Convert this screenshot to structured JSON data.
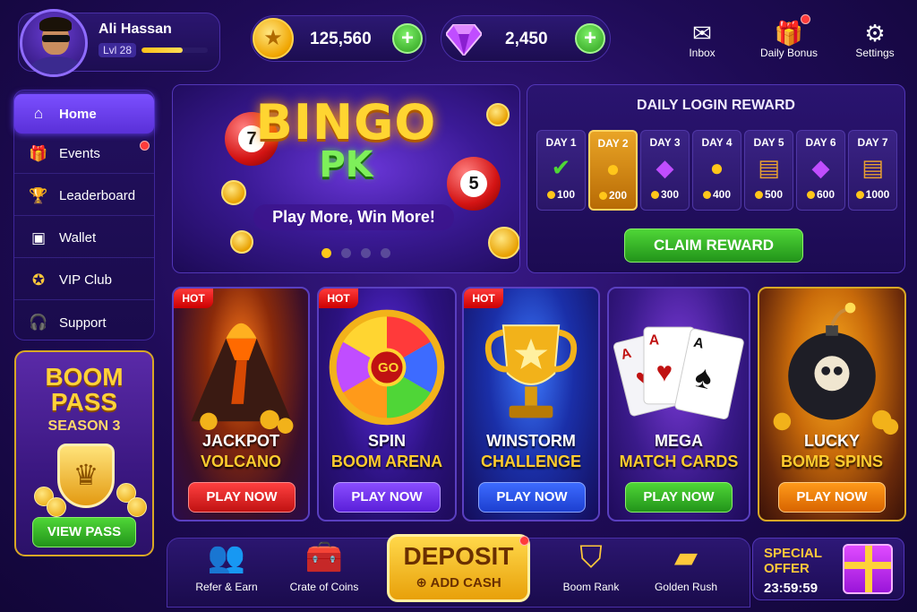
{
  "profile": {
    "name": "Ali Hassan",
    "level": "Lvl 28",
    "xp_progress": 0.62
  },
  "currency": {
    "coins": "125,560",
    "gems": "2,450"
  },
  "top_icons": {
    "inbox": "Inbox",
    "daily_bonus": "Daily Bonus",
    "settings": "Settings"
  },
  "sidebar": {
    "items": [
      {
        "label": "Home",
        "icon": "home-icon"
      },
      {
        "label": "Events",
        "icon": "gift-icon"
      },
      {
        "label": "Leaderboard",
        "icon": "trophy-icon"
      },
      {
        "label": "Wallet",
        "icon": "wallet-icon"
      },
      {
        "label": "VIP Club",
        "icon": "star-icon"
      },
      {
        "label": "Support",
        "icon": "headset-icon"
      }
    ]
  },
  "boom_pass": {
    "title_line1": "BOOM",
    "title_line2": "PASS",
    "season": "SEASON 3",
    "button": "VIEW PASS"
  },
  "banner": {
    "title": "BINGO",
    "subtitle": "PK",
    "tagline": "Play More, Win More!",
    "ball_left": "7",
    "ball_right": "5",
    "slides": 4,
    "active_slide": 1
  },
  "daily_reward": {
    "title": "DAILY LOGIN REWARD",
    "days": [
      {
        "label": "DAY 1",
        "amount": "100",
        "icon": "check-icon"
      },
      {
        "label": "DAY 2",
        "amount": "200",
        "icon": "coins-icon"
      },
      {
        "label": "DAY 3",
        "amount": "300",
        "icon": "gem-icon"
      },
      {
        "label": "DAY 4",
        "amount": "400",
        "icon": "coins-icon"
      },
      {
        "label": "DAY 5",
        "amount": "500",
        "icon": "chest-icon"
      },
      {
        "label": "DAY 6",
        "amount": "600",
        "icon": "gem-icon"
      },
      {
        "label": "DAY 7",
        "amount": "1000",
        "icon": "chest-icon"
      }
    ],
    "current_day": 2,
    "claim_button": "CLAIM REWARD"
  },
  "games": [
    {
      "line1": "JACKPOT",
      "line2": "VOLCANO",
      "badge": "HOT",
      "button": "PLAY NOW"
    },
    {
      "line1": "SPIN",
      "line2": "BOOM ARENA",
      "badge": "HOT",
      "button": "PLAY NOW",
      "wheel_center": "GO"
    },
    {
      "line1": "WINSTORM",
      "line2": "CHALLENGE",
      "badge": "HOT",
      "button": "PLAY NOW"
    },
    {
      "line1": "MEGA",
      "line2": "MATCH CARDS",
      "badge": "",
      "button": "PLAY NOW"
    },
    {
      "line1": "LUCKY",
      "line2": "BOMB SPINS",
      "badge": "",
      "button": "PLAY NOW"
    }
  ],
  "bottom_bar": {
    "refer": "Refer & Earn",
    "crate": "Crate of Coins",
    "deposit_title": "DEPOSIT",
    "deposit_sub": "ADD CASH",
    "rank": "Boom Rank",
    "gold": "Golden Rush"
  },
  "special_offer": {
    "title": "SPECIAL OFFER",
    "timer": "23:59:59"
  },
  "colors": {
    "accent": "#7b4fff",
    "gold": "#ffd531",
    "green": "#4fd637",
    "hot": "#ff3a3a"
  }
}
